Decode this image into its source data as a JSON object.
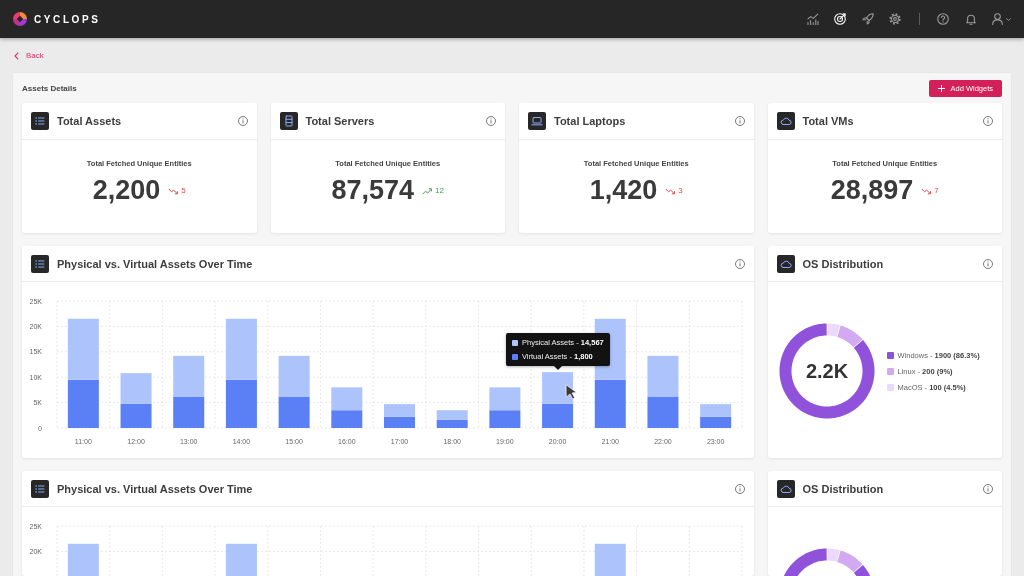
{
  "header": {
    "brand": "CYCLOPS",
    "nav": [
      {
        "selected": false
      },
      {
        "selected": true
      },
      {
        "selected": false
      },
      {
        "selected": false
      }
    ]
  },
  "back_link": {
    "label": "Back"
  },
  "section": {
    "title": "Assets Details",
    "button": "Add Widgets"
  },
  "stat_cards": [
    {
      "title": "Total Assets",
      "caption": "Total Fetched Unique Entities",
      "value": "2,200",
      "trend": {
        "up": false,
        "change": "5"
      }
    },
    {
      "title": "Total Servers",
      "caption": "Total Fetched Unique Entities",
      "value": "87,574",
      "trend": {
        "up": true,
        "change": "12"
      }
    },
    {
      "title": "Total Laptops",
      "caption": "Total Fetched Unique Entities",
      "value": "1,420",
      "trend": {
        "up": false,
        "change": "3"
      }
    },
    {
      "title": "Total VMs",
      "caption": "Total Fetched Unique Entities",
      "value": "28,897",
      "trend": {
        "up": false,
        "change": "7"
      }
    }
  ],
  "widgets": [
    {
      "kind": "bar_chart",
      "title": "Physical vs. Virtual Assets Over Time",
      "chart_data": {
        "type": "bar",
        "stacked": true,
        "grid": true,
        "categories": [
          "11:00",
          "12:00",
          "13:00",
          "14:00",
          "15:00",
          "16:00",
          "17:00",
          "18:00",
          "19:00",
          "20:00",
          "21:00",
          "22:00",
          "23:00"
        ],
        "ylim": [
          0,
          25000
        ],
        "yticks": [
          0,
          {
            "value": 5000,
            "label": "5K"
          },
          {
            "value": 10000,
            "label": "10K"
          },
          {
            "value": 15000,
            "label": "15K"
          },
          {
            "value": 20000,
            "label": "20K"
          },
          {
            "value": 25000,
            "label": "25K"
          }
        ],
        "series": [
          {
            "color": "#5b7ff5",
            "values": [
              9500,
              4800,
              6200,
              9500,
              6200,
              3500,
              2200,
              1600,
              3500,
              4800,
              9500,
              6200,
              2200
            ]
          },
          {
            "color": "#adc3fc",
            "values": [
              12000,
              6000,
              8000,
              12000,
              8000,
              4500,
              2500,
              1900,
              4500,
              6200,
              12000,
              8000,
              2500
            ]
          }
        ]
      },
      "tooltip": {
        "rows": [
          {
            "text": "Physical Assets - **14,567**",
            "color": "#adc3fc"
          },
          {
            "text": "Virtual Assets - **1,800**",
            "color": "#5b7ff5"
          }
        ]
      }
    },
    {
      "kind": "donut_chart",
      "title": "OS Distribution",
      "center_label": "2.2K",
      "chart_data": {
        "type": "donut",
        "values": [
          86.3,
          9,
          4.5
        ],
        "colors": [
          "#9152db",
          "#d3a9f2",
          "#ecdafc"
        ]
      },
      "legend": [
        {
          "label": "Windows - **1900 (86.3%)**"
        },
        {
          "label": "Linux - **200 (9%)**"
        },
        {
          "label": "MacOS - **100 (4.5%)**"
        }
      ]
    },
    {
      "kind": "bar_chart",
      "title": "Physical vs. Virtual Assets Over Time",
      "chart_data": {
        "type": "bar",
        "grid": true,
        "ylim": [
          0,
          25000
        ],
        "yticks": [
          {
            "value": 20000,
            "label": "20K"
          },
          {
            "value": 25000,
            "label": "25K"
          }
        ],
        "series": [
          {
            "color": "#adc3fc",
            "values": [
              21500,
              null,
              null,
              21500,
              null,
              null,
              null,
              null,
              null,
              null,
              21500,
              null,
              null
            ]
          }
        ]
      }
    },
    {
      "kind": "donut_chart",
      "title": "OS Distribution",
      "chart_data": {
        "type": "donut",
        "values": [
          86.3,
          9,
          4.5
        ],
        "colors": [
          "#9152db",
          "#d3a9f2",
          "#ecdafc"
        ]
      }
    }
  ]
}
